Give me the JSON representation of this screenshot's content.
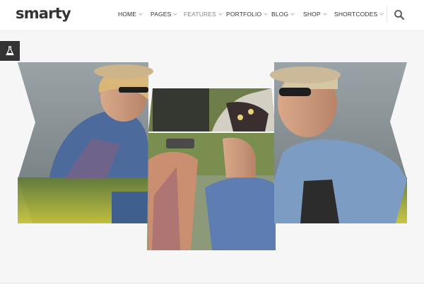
{
  "brand": {
    "logo": "smarty"
  },
  "nav": {
    "items": [
      {
        "label": "HOME",
        "has_dropdown": true,
        "active": false
      },
      {
        "label": "PAGES",
        "has_dropdown": true,
        "active": false
      },
      {
        "label": "FEATURES",
        "has_dropdown": true,
        "active": true
      },
      {
        "label": "PORTFOLIO",
        "has_dropdown": true,
        "active": false
      },
      {
        "label": "BLOG",
        "has_dropdown": true,
        "active": false
      },
      {
        "label": "SHOP",
        "has_dropdown": true,
        "active": false
      },
      {
        "label": "SHORTCODES",
        "has_dropdown": true,
        "active": false
      }
    ],
    "search_icon": "search-icon"
  },
  "side_tab": {
    "icon": "flask-icon"
  },
  "slider": {
    "image_description_icon": "photo-collage",
    "tiles": [
      "left-panel",
      "center-top-panel",
      "center-bottom-panel",
      "right-panel"
    ]
  },
  "colors": {
    "header_bg": "#ffffff",
    "page_bg": "#f6f6f6",
    "text_dark": "#333333",
    "text_active": "#888888",
    "side_tab_bg": "#333333"
  }
}
